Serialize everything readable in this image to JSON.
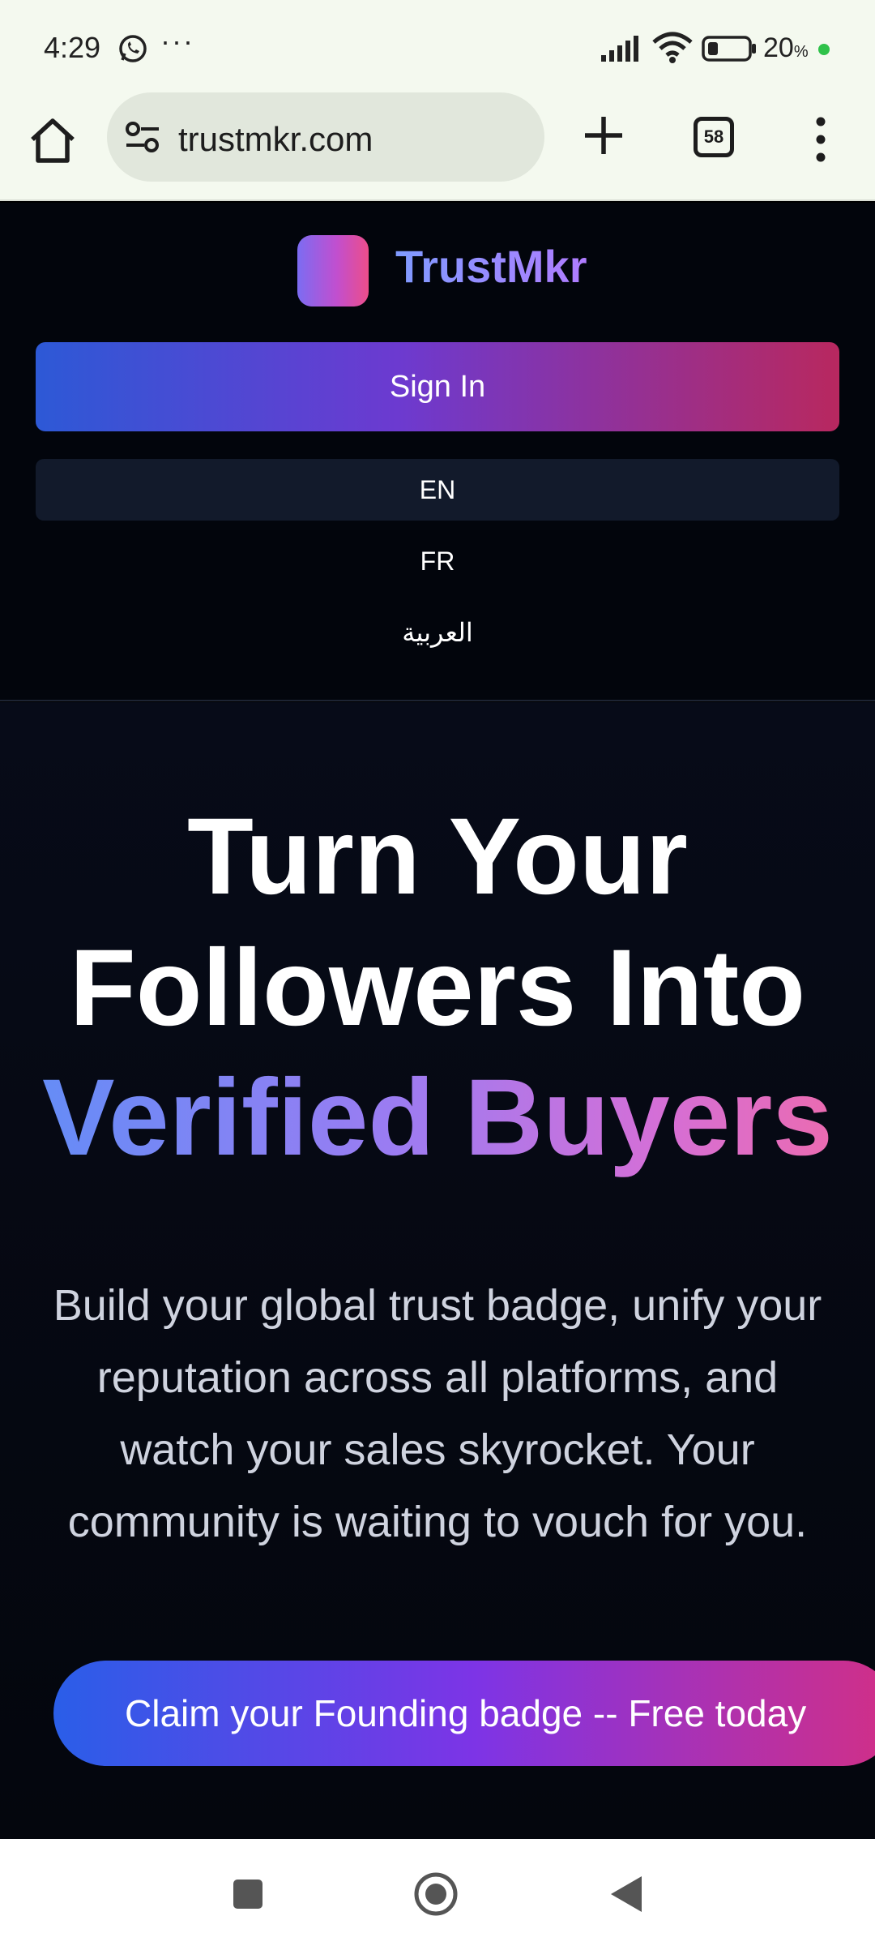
{
  "status_bar": {
    "time": "4:29",
    "more_indicator": "···",
    "battery_percent": "20",
    "battery_unit": "%",
    "icons": [
      "whatsapp-icon",
      "signal-icon",
      "wifi-icon",
      "battery-icon"
    ]
  },
  "browser": {
    "url": "trustmkr.com",
    "tab_count": "58",
    "icons": [
      "home-icon",
      "site-settings-icon",
      "new-tab-icon",
      "more-menu-icon"
    ]
  },
  "site": {
    "brand_name": "TrustMkr",
    "sign_in_label": "Sign In",
    "languages": [
      "EN",
      "FR",
      "العربية"
    ],
    "selected_language": "EN"
  },
  "hero": {
    "title_line1": "Turn Your",
    "title_line2": "Followers Into",
    "title_accent": "Verified Buyers",
    "subtitle": "Build your global trust badge, unify your reputation across all platforms, and watch your sales skyrocket. Your community is waiting to vouch for you.",
    "cta_label": "Claim your Founding badge -- Free today"
  },
  "colors": {
    "page_bg": "#02050c",
    "browser_chrome": "#f4f9ef",
    "brand_text": "#8a84ff",
    "accent_start": "#5f8ef7",
    "accent_end": "#f06aa8",
    "battery_dot": "#2fc24a"
  },
  "nav_bar": {
    "icons": [
      "recents-square-icon",
      "home-circle-icon",
      "back-triangle-icon"
    ]
  }
}
